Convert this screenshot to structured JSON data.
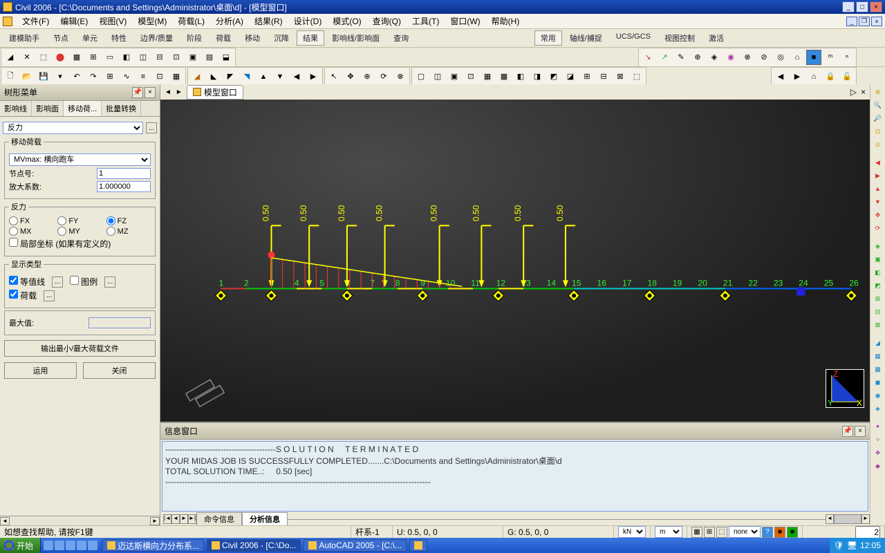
{
  "title": "Civil 2006 - [C:\\Documents and Settings\\Administrator\\桌面\\d] - [模型窗口]",
  "menus": [
    "文件(F)",
    "编辑(E)",
    "视图(V)",
    "模型(M)",
    "荷载(L)",
    "分析(A)",
    "结果(R)",
    "设计(D)",
    "模式(O)",
    "查询(Q)",
    "工具(T)",
    "窗口(W)",
    "帮助(H)"
  ],
  "upperTabsL": [
    "建模助手",
    "节点",
    "单元",
    "特性",
    "边界/质量",
    "阶段",
    "荷载",
    "移动",
    "沉降",
    "结果",
    "影响线/影响面",
    "查询"
  ],
  "upperTabsR": [
    "常用",
    "轴线/捕捉",
    "UCS/GCS",
    "视图控制",
    "激活"
  ],
  "upperActiveL": "结果",
  "upperActiveR": "常用",
  "treePanel": {
    "title": "树形菜单",
    "tabs": [
      "影响线",
      "影响面",
      "移动荷...",
      "批量转换"
    ],
    "active": "移动荷...",
    "mainSelect": "反力",
    "movingLoad": {
      "legend": "移动荷载",
      "select": "MVmax: 横向跑车",
      "nodeLabel": "节点号:",
      "nodeValue": "1",
      "scaleLabel": "放大系数:",
      "scaleValue": "1.000000"
    },
    "reaction": {
      "legend": "反力",
      "options": [
        "FX",
        "FY",
        "FZ",
        "MX",
        "MY",
        "MZ"
      ],
      "checked": "FZ",
      "localLabel": "局部坐标 (如果有定义的)"
    },
    "display": {
      "legend": "显示类型",
      "contourLabel": "等值线",
      "legendLabel": "图例",
      "loadLabel": "荷载"
    },
    "maxLabel": "最大值:",
    "btnOutput": "输出最小/最大荷载文件",
    "btnApply": "运用",
    "btnClose": "关闭"
  },
  "modelTab": "模型窗口",
  "msgWindow": {
    "title": "信息窗口",
    "line1": "----------------------------------------S O L U T I O N     T E R M I N A T E D",
    "line2": "YOUR MIDAS JOB IS SUCCESSFULLY COMPLETED.......C:\\Documents and Settings\\Administrator\\桌面\\d",
    "line3": "TOTAL SOLUTION TIME..:     0.50 [sec]",
    "line4": "------------------------------------------------------------------------------------------------",
    "tabs": [
      "命令信息",
      "分析信息"
    ],
    "active": "分析信息"
  },
  "statusBar": {
    "help": "如想查找帮助, 请按F1键",
    "frame": "杆系-1",
    "u": "U: 0.5, 0, 0",
    "g": "G: 0.5, 0, 0",
    "unit1": "kN",
    "unit2": "m",
    "unitEnd": "none",
    "num": "2"
  },
  "taskbar": {
    "start": "开始",
    "items": [
      "迈达斯横向力分布系...",
      "Civil 2006 - [C:\\Do...",
      "AutoCAD 2005 - [C:\\...",
      ""
    ],
    "activeIdx": 1,
    "time": "12:05"
  },
  "loadLabels": [
    "0.50",
    "0.50",
    "0.50",
    "0.50",
    "0.50",
    "0.50",
    "0.50",
    "0.50"
  ],
  "nodeNums": [
    1,
    2,
    3,
    4,
    5,
    6,
    7,
    8,
    9,
    10,
    11,
    12,
    13,
    14,
    15,
    16,
    17,
    18,
    19,
    20,
    21,
    22,
    23,
    24,
    25,
    26
  ]
}
